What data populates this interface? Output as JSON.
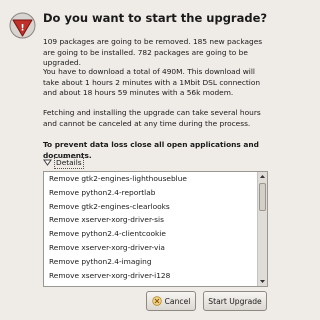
{
  "dialog": {
    "title": "Do you want to start the upgrade?",
    "paragraphs": [
      "109 packages are going to be removed. 185 new packages are going to be installed. 782 packages are going to be upgraded.",
      "You have to download a total of 490M. This download will take about 1 hours 2 minutes with a 1Mbit DSL connection and about 18 hours 59 minutes with a 56k modem.",
      "Fetching and installing the upgrade can take several hours and cannot be canceled at any time during the process.",
      "To prevent data loss close all open applications and documents."
    ],
    "icon": "warning-icon"
  },
  "details": {
    "label": "Details",
    "expanded": true,
    "items": [
      "Remove gtk2-engines-lighthouseblue",
      "Remove python2.4-reportlab",
      "Remove gtk2-engines-clearlooks",
      "Remove xserver-xorg-driver-sis",
      "Remove python2.4-clientcookie",
      "Remove xserver-xorg-driver-via",
      "Remove python2.4-imaging",
      "Remove xserver-xorg-driver-i128"
    ]
  },
  "buttons": {
    "cancel_label": "Cancel",
    "start_label": "Start Upgrade"
  },
  "colors": {
    "background": "#efebe7",
    "warning_red": "#c0302a"
  }
}
